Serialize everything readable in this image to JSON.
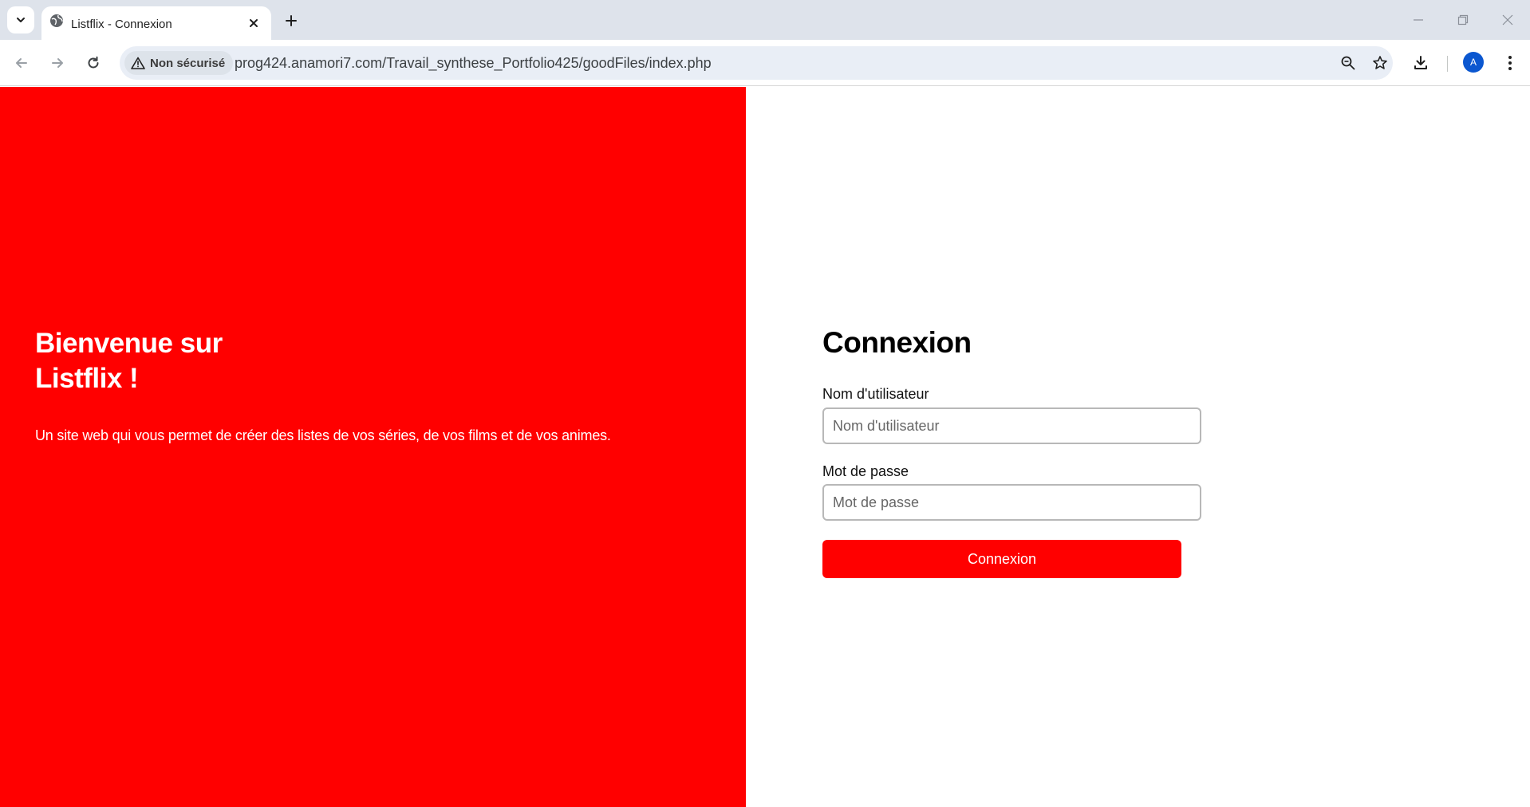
{
  "browser": {
    "tab_title": "Listflix - Connexion",
    "security_label": "Non sécurisé",
    "url": "prog424.anamori7.com/Travail_synthese_Portfolio425/goodFiles/index.php",
    "profile_initial": "A",
    "icons": {
      "tab_search": "chevron-down-icon",
      "favicon": "globe-icon",
      "tab_close": "close-icon",
      "new_tab": "plus-icon",
      "back": "arrow-left-icon",
      "forward": "arrow-right-icon",
      "reload": "reload-icon",
      "security": "warning-icon",
      "zoom": "zoom-out-icon",
      "bookmark": "star-icon",
      "downloads": "download-icon",
      "menu": "kebab-menu-icon"
    }
  },
  "hero": {
    "title": "Bienvenue sur Listflix !",
    "description": "Un site web qui vous permet de créer des listes de vos séries, de vos films et de vos animes."
  },
  "login": {
    "title": "Connexion",
    "username_label": "Nom d'utilisateur",
    "username_placeholder": "Nom d'utilisateur",
    "password_label": "Mot de passe",
    "password_placeholder": "Mot de passe",
    "submit_label": "Connexion"
  },
  "colors": {
    "brand_red": "#ff0000",
    "tabbar": "#dee3eb",
    "omnibox": "#e9eef6",
    "avatar": "#0b57d0"
  }
}
